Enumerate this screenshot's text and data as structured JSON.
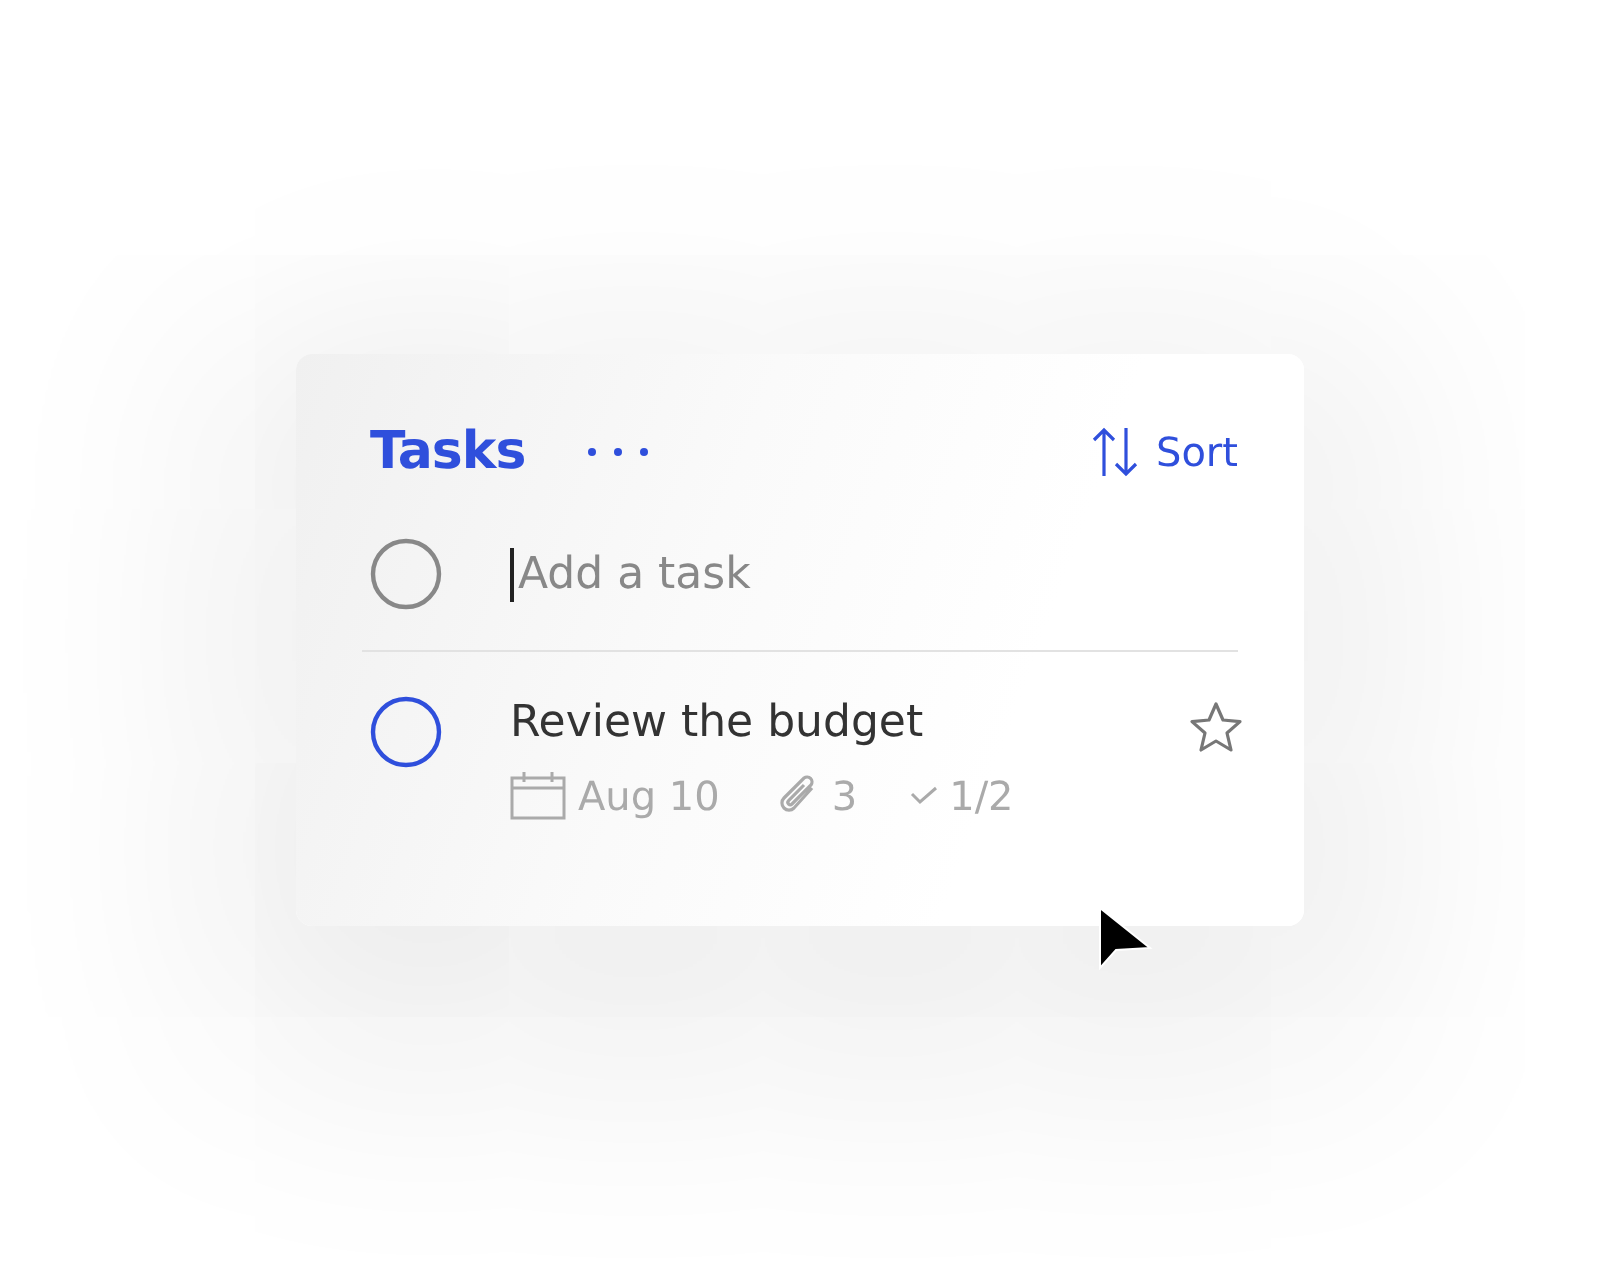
{
  "header": {
    "title": "Tasks",
    "sort_label": "Sort"
  },
  "add_task": {
    "placeholder": "Add a task"
  },
  "tasks": [
    {
      "title": "Review the budget",
      "completed": false,
      "starred": false,
      "due": "Aug 10",
      "attachments": "3",
      "steps": "1/2"
    }
  ]
}
